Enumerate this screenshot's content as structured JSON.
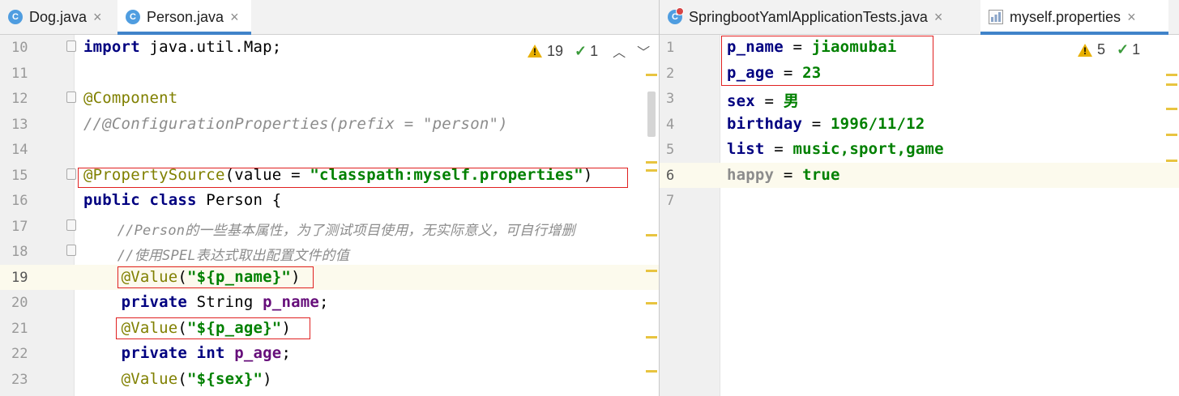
{
  "left_editor": {
    "tabs": [
      {
        "label": "Dog.java",
        "icon": "java-class-icon",
        "close": "×"
      },
      {
        "label": "Person.java",
        "icon": "java-class-icon",
        "close": "×"
      }
    ],
    "inspection": {
      "warnings": "19",
      "checks": "1"
    },
    "lines": [
      {
        "num": "10"
      },
      {
        "num": "11"
      },
      {
        "num": "12"
      },
      {
        "num": "13"
      },
      {
        "num": "14"
      },
      {
        "num": "15"
      },
      {
        "num": "16"
      },
      {
        "num": "17"
      },
      {
        "num": "18"
      },
      {
        "num": "19"
      },
      {
        "num": "20"
      },
      {
        "num": "21"
      },
      {
        "num": "22"
      },
      {
        "num": "23"
      }
    ],
    "code": {
      "l10_kw": "import",
      "l10_rest": " java.util.Map;",
      "l12": "@Component",
      "l13": "//@ConfigurationProperties(prefix = \"person\")",
      "l15_ann": "@PropertySource",
      "l15_mid": "(value = ",
      "l15_str": "\"classpath:myself.properties\"",
      "l15_end": ")",
      "l16_kw": "public class",
      "l16_rest": " Person {",
      "l17": "    //Person的一些基本属性，为了测试项目使用，无实际意义，可自行增删",
      "l18": "    //使用SPEL表达式取出配置文件的值",
      "l19_ann": "@Value",
      "l19_p1": "(",
      "l19_str": "\"${p_name}\"",
      "l19_p2": ")",
      "l20_kw": "private",
      "l20_type": " String ",
      "l20_fld": "p_name",
      "l20_end": ";",
      "l21_ann": "@Value",
      "l21_p1": "(",
      "l21_str": "\"${p_age}\"",
      "l21_p2": ")",
      "l22_kw": "private int",
      "l22_sp": " ",
      "l22_fld": "p_age",
      "l22_end": ";",
      "l23_ann": "@Value",
      "l23_p1": "(",
      "l23_str": "\"${sex}\"",
      "l23_p2": ")",
      "indent": "    "
    }
  },
  "right_editor": {
    "tabs": [
      {
        "label": "SpringbootYamlApplicationTests.java",
        "icon": "java-test-class-icon",
        "close": "×"
      },
      {
        "label": "myself.properties",
        "icon": "properties-file-icon",
        "close": "×"
      }
    ],
    "inspection": {
      "warnings": "5",
      "checks": "1"
    },
    "lines": [
      {
        "num": "1",
        "key": "p_name",
        "eq": " = ",
        "value": "jiaomubai"
      },
      {
        "num": "2",
        "key": "p_age",
        "eq": " = ",
        "value": "23"
      },
      {
        "num": "3",
        "key": "sex",
        "eq": " = ",
        "value": "男"
      },
      {
        "num": "4",
        "key": "birthday",
        "eq": " = ",
        "value": "1996/11/12"
      },
      {
        "num": "5",
        "key": "list",
        "eq": " = ",
        "value": "music,sport,game"
      },
      {
        "num": "6",
        "key": "happy",
        "eq": " = ",
        "value": "true"
      },
      {
        "num": "7",
        "key": "",
        "eq": "",
        "value": ""
      }
    ]
  },
  "colors": {
    "highlight_box": "#e02020",
    "active_tab_underline": "#4083c9",
    "current_line": "#fcfaed"
  }
}
